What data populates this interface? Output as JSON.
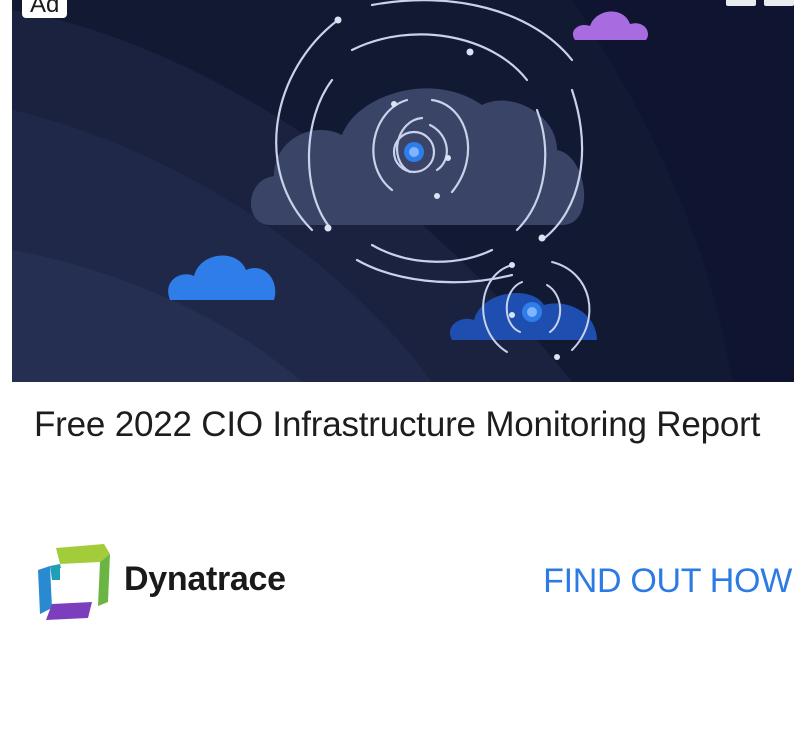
{
  "ad": {
    "badge_label": "Ad",
    "headline": "Free 2022 CIO Infrastructure Monitoring Report",
    "advertiser": "Dynatrace",
    "cta_label": "FIND OUT HOW"
  },
  "hero": {
    "icon": "cloud-orbit-illustration",
    "background_color": "#131a34",
    "accent_blue": "#2f7de8",
    "accent_purple": "#a86be0"
  },
  "brand": {
    "logo_icon": "dynatrace-logo-icon",
    "cta_color": "#2c7be5"
  }
}
